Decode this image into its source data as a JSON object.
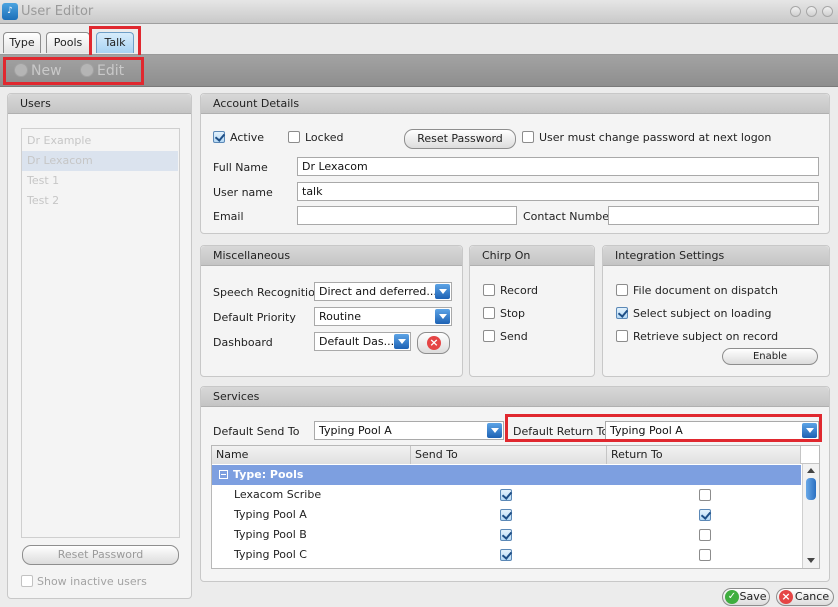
{
  "window": {
    "title": "User Editor"
  },
  "tabs": [
    {
      "label": "Type"
    },
    {
      "label": "Pools"
    },
    {
      "label": "Talk"
    }
  ],
  "toolbar": {
    "new_label": "New",
    "edit_label": "Edit"
  },
  "users_panel": {
    "title": "Users",
    "items": [
      "Dr Example",
      "Dr Lexacom",
      "Test 1",
      "Test 2"
    ],
    "selected": "Dr Lexacom",
    "reset_password_label": "Reset Password",
    "show_inactive_label": "Show inactive users"
  },
  "account": {
    "title": "Account Details",
    "active_label": "Active",
    "locked_label": "Locked",
    "reset_password_label": "Reset Password",
    "must_change_label": "User must change password at next logon",
    "full_name_label": "Full Name",
    "full_name_value": "Dr Lexacom",
    "username_label": "User name",
    "username_value": "talk",
    "email_label": "Email",
    "email_value": "",
    "contact_label": "Contact Number",
    "contact_value": ""
  },
  "misc": {
    "title": "Miscellaneous",
    "speech_label": "Speech Recognition",
    "speech_value": "Direct and deferred...",
    "priority_label": "Default Priority",
    "priority_value": "Routine",
    "dashboard_label": "Dashboard",
    "dashboard_value": "Default Das..."
  },
  "chirp": {
    "title": "Chirp On",
    "record_label": "Record",
    "stop_label": "Stop",
    "send_label": "Send"
  },
  "integration": {
    "title": "Integration Settings",
    "file_doc_label": "File document on dispatch",
    "select_subject_label": "Select subject on loading",
    "retrieve_subject_label": "Retrieve subject on record",
    "enable_button_label": "Enable Integrations"
  },
  "services": {
    "title": "Services",
    "send_to_label": "Default Send To",
    "send_to_value": "Typing Pool A",
    "return_to_label": "Default Return To",
    "return_to_value": "Typing Pool A",
    "columns": [
      "Name",
      "Send To",
      "Return To"
    ],
    "group_label": "Type: Pools",
    "rows": [
      {
        "name": "Lexacom Scribe",
        "send": true,
        "return": false
      },
      {
        "name": "Typing Pool A",
        "send": true,
        "return": true
      },
      {
        "name": "Typing Pool B",
        "send": true,
        "return": false
      },
      {
        "name": "Typing Pool C",
        "send": true,
        "return": false
      }
    ]
  },
  "footer": {
    "save_label": "Save",
    "cancel_label": "Cance"
  },
  "colors": {
    "highlight_red": "#e0282f",
    "accent_blue": "#1d62b4",
    "group_row": "#7d9fe0"
  }
}
